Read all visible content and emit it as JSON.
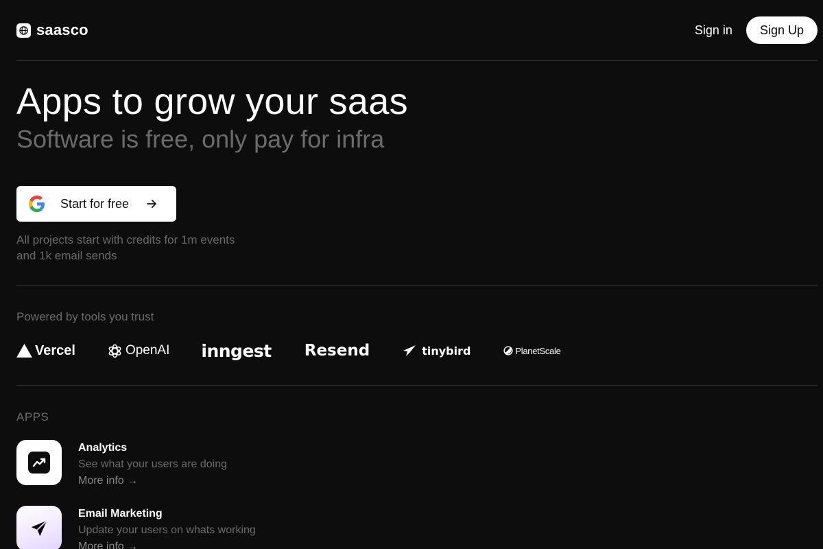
{
  "header": {
    "logo_text": "saasco",
    "logo_icon": "globe-icon",
    "signin_label": "Sign in",
    "signup_label": "Sign Up"
  },
  "hero": {
    "title": "Apps to grow your saas",
    "subtitle": "Software is free, only pay for infra",
    "cta_label": "Start for free",
    "cta_icon": "google-icon",
    "cta_arrow_icon": "arrow-right-icon",
    "credits_note": "All projects start with credits for 1m events and 1k email sends"
  },
  "powered": {
    "label": "Powered by tools you trust",
    "brands": [
      {
        "name": "Vercel",
        "icon": "vercel-triangle-icon"
      },
      {
        "name": "OpenAI",
        "icon": "openai-knot-icon"
      },
      {
        "name": "inngest",
        "icon": ""
      },
      {
        "name": "Resend",
        "icon": ""
      },
      {
        "name": "tinybird",
        "icon": "tinybird-bird-icon"
      },
      {
        "name": "PlanetScale",
        "icon": "planetscale-icon"
      }
    ]
  },
  "apps": {
    "label": "APPS",
    "items": [
      {
        "name": "Analytics",
        "description": "See what your users are doing",
        "more_label": "More info →",
        "icon": "trending-up-icon"
      },
      {
        "name": "Email Marketing",
        "description": "Update your users on whats working",
        "more_label": "More info →",
        "icon": "paper-plane-icon"
      }
    ]
  },
  "colors": {
    "background": "#0d0d0d",
    "text_primary": "#ffffff",
    "text_muted": "#6b6b6b",
    "divider": "#333333",
    "button_bg": "#ffffff"
  }
}
